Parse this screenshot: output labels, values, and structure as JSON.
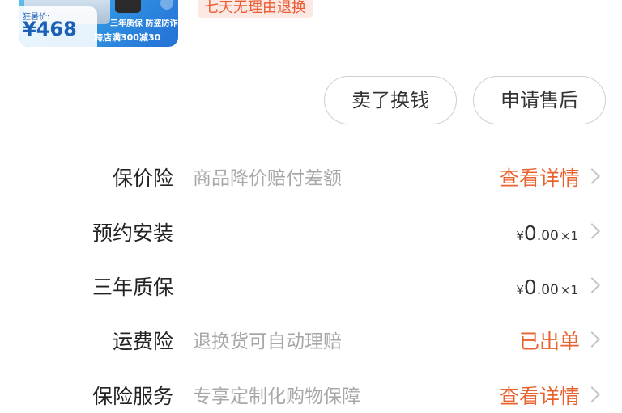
{
  "product": {
    "price_label": "狂暑价:",
    "price": "¥468",
    "promo_line1": "三年质保 防盗防诈",
    "promo_line2": "跨店满300减30",
    "return_policy": "七天无理由退换"
  },
  "actions": {
    "sell_label": "卖了换钱",
    "aftersale_label": "申请售后"
  },
  "services": [
    {
      "label": "保价险",
      "desc": "商品降价赔付差额",
      "action": "查看详情"
    },
    {
      "label": "预约安装",
      "currency": "¥",
      "amount_int": "0",
      "amount_dec": ".00",
      "quantity": "×1"
    },
    {
      "label": "三年质保",
      "currency": "¥",
      "amount_int": "0",
      "amount_dec": ".00",
      "quantity": "×1"
    },
    {
      "label": "运费险",
      "desc": "退换货可自动理赔",
      "action": "已出单"
    },
    {
      "label": "保险服务",
      "desc": "专享定制化购物保障",
      "action": "查看详情"
    }
  ],
  "colors": {
    "accent": "#e8632f",
    "muted_text": "#a8a8a8",
    "thumbnail_blue": "#2f8fe0"
  },
  "icons": [
    "chevron-right-icon"
  ]
}
